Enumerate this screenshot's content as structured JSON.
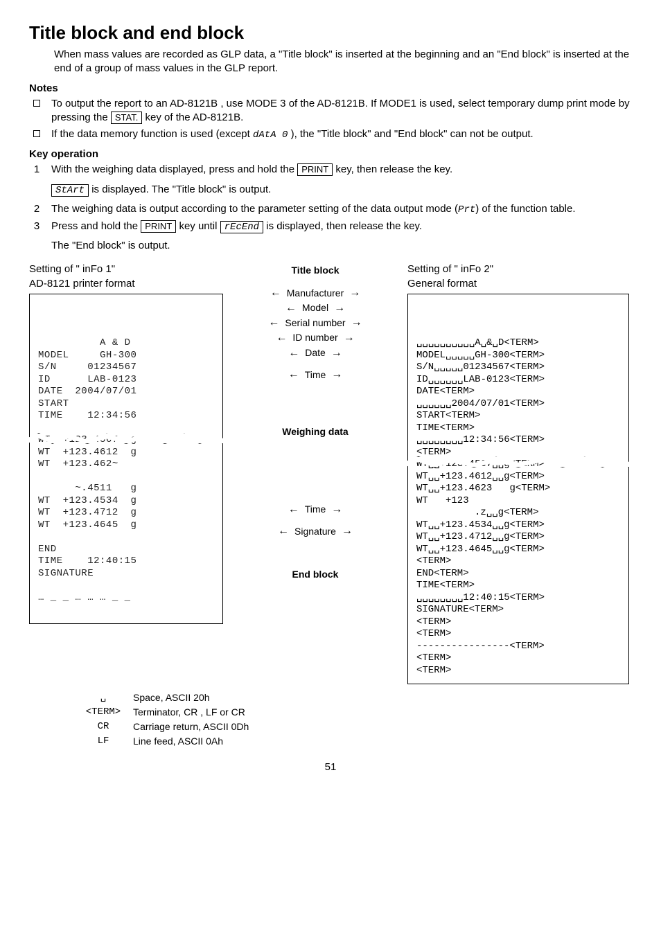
{
  "title": "Title block and end block",
  "intro": "When mass values are recorded as GLP data, a \"Title block\" is inserted at the beginning and an \"End block\" is inserted at the end of a group of mass values in the GLP report.",
  "notes_heading": "Notes",
  "notes": [
    {
      "pre": "To output the report to an AD-8121B , use MODE 3 of the AD-8121B. If MODE1 is used, select temporary dump print mode by pressing the ",
      "key": "STAT.",
      "post": " key of the AD-8121B."
    },
    {
      "pre": "If the data memory function is used (except ",
      "seg": "dAtA 0",
      "post": "), the \"Title block\" and \"End block\" can not be output."
    }
  ],
  "keyop_heading": "Key operation",
  "keyop": [
    {
      "num": "1",
      "line1_pre": "With the weighing data displayed, press and hold the ",
      "line1_key": "PRINT",
      "line1_post": " key, then release the key.",
      "line2_key": "StArt",
      "line2_post": " is displayed. The \"Title block\" is output."
    },
    {
      "num": "2",
      "text_pre": "The weighing data is output according to the parameter setting of the data output mode (",
      "text_seg": "Prt",
      "text_post": ") of the function table."
    },
    {
      "num": "3",
      "line1_pre": "Press and hold the ",
      "line1_key1": "PRINT",
      "line1_mid": " key until ",
      "line1_key2": "rEcEnd",
      "line1_post": " is displayed, then release the key.",
      "line2": "The \"End block\" is output."
    }
  ],
  "diagram": {
    "left_header1": "Setting of \" inFo  1\"",
    "left_header2": "AD-8121 printer format",
    "right_header1": "Setting of \" inFo  2\"",
    "right_header2": "General format",
    "title_block_label": "Title block",
    "weighing_data_label": "Weighing data",
    "end_block_label": "End block",
    "mid_labels": {
      "manufacturer": "Manufacturer",
      "model": "Model",
      "serial": "Serial number",
      "id": "ID number",
      "date": "Date",
      "time": "Time",
      "time2": "Time",
      "signature": "Signature"
    },
    "left_paper": [
      "          A & D",
      "MODEL     GH-300",
      "S/N     01234567",
      "ID      LAB-0123",
      "DATE  2004/07/01",
      "START",
      "TIME    12:34:56",
      "",
      "WT  +123.4567  g",
      "WT  +123.4612  g",
      "WT  +123.462~   ",
      "                ",
      "      ~.4511   g",
      "WT  +123.4534  g",
      "WT  +123.4712  g",
      "WT  +123.4645  g",
      "",
      "END",
      "TIME    12:40:15",
      "SIGNATURE",
      "",
      "… _ _ … … … _ _",
      ""
    ],
    "right_paper": [
      "␣␣␣␣␣␣␣␣␣␣A␣&␣D<TERM>",
      "MODEL␣␣␣␣␣GH-300<TERM>",
      "S/N␣␣␣␣␣01234567<TERM>",
      "ID␣␣␣␣␣␣LAB-0123<TERM>",
      "DATE<TERM>",
      "␣␣␣␣␣␣2004/07/01<TERM>",
      "START<TERM>",
      "TIME<TERM>",
      "␣␣␣␣␣␣␣␣12:34:56<TERM>",
      "<TERM>",
      "WT␣␣+123.4567␣␣g<TERM>",
      "WT␣␣+123.4612␣␣g<TERM>",
      "WT␣␣+123.4623   g<TERM>",
      "WT   +123              ",
      "          .z␣␣g<TERM>",
      "WT␣␣+123.4534␣␣g<TERM>",
      "WT␣␣+123.4712␣␣g<TERM>",
      "WT␣␣+123.4645␣␣g<TERM>",
      "<TERM>",
      "END<TERM>",
      "TIME<TERM>",
      "␣␣␣␣␣␣␣␣12:40:15<TERM>",
      "SIGNATURE<TERM>",
      "<TERM>",
      "<TERM>",
      "----------------<TERM>",
      "<TERM>",
      "<TERM>"
    ]
  },
  "legend": {
    "space_sym": "␣",
    "space": "Space, ASCII 20h",
    "term_sym": "<TERM>",
    "term": "Terminator, CR , LF or CR",
    "cr_sym": "CR",
    "cr": "Carriage return, ASCII 0Dh",
    "lf_sym": "LF",
    "lf": "Line feed, ASCII 0Ah"
  },
  "page_number": "51"
}
